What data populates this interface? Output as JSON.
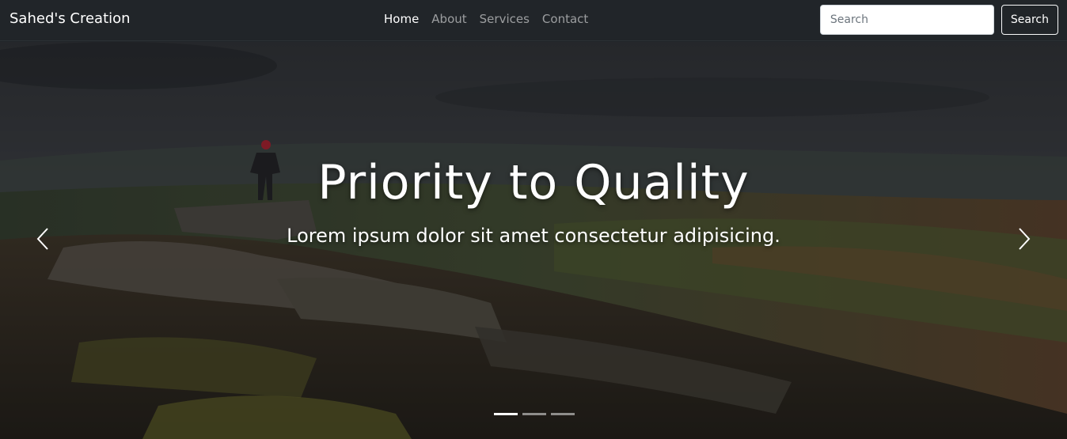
{
  "navbar": {
    "brand": "Sahed's Creation",
    "links": [
      {
        "label": "Home",
        "active": true
      },
      {
        "label": "About",
        "active": false
      },
      {
        "label": "Services",
        "active": false
      },
      {
        "label": "Contact",
        "active": false
      }
    ],
    "search": {
      "placeholder": "Search",
      "value": "",
      "button_label": "Search"
    }
  },
  "carousel": {
    "title": "Priority to Quality",
    "subtitle": "Lorem ipsum dolor sit amet consectetur adipisicing.",
    "indicators_count": 3,
    "active_indicator": 0,
    "prev_icon": "chevron-left-icon",
    "next_icon": "chevron-right-icon"
  },
  "colors": {
    "navbar_bg": "#212529",
    "text_light": "#ffffff",
    "nav_muted": "rgba(255,255,255,0.55)"
  }
}
